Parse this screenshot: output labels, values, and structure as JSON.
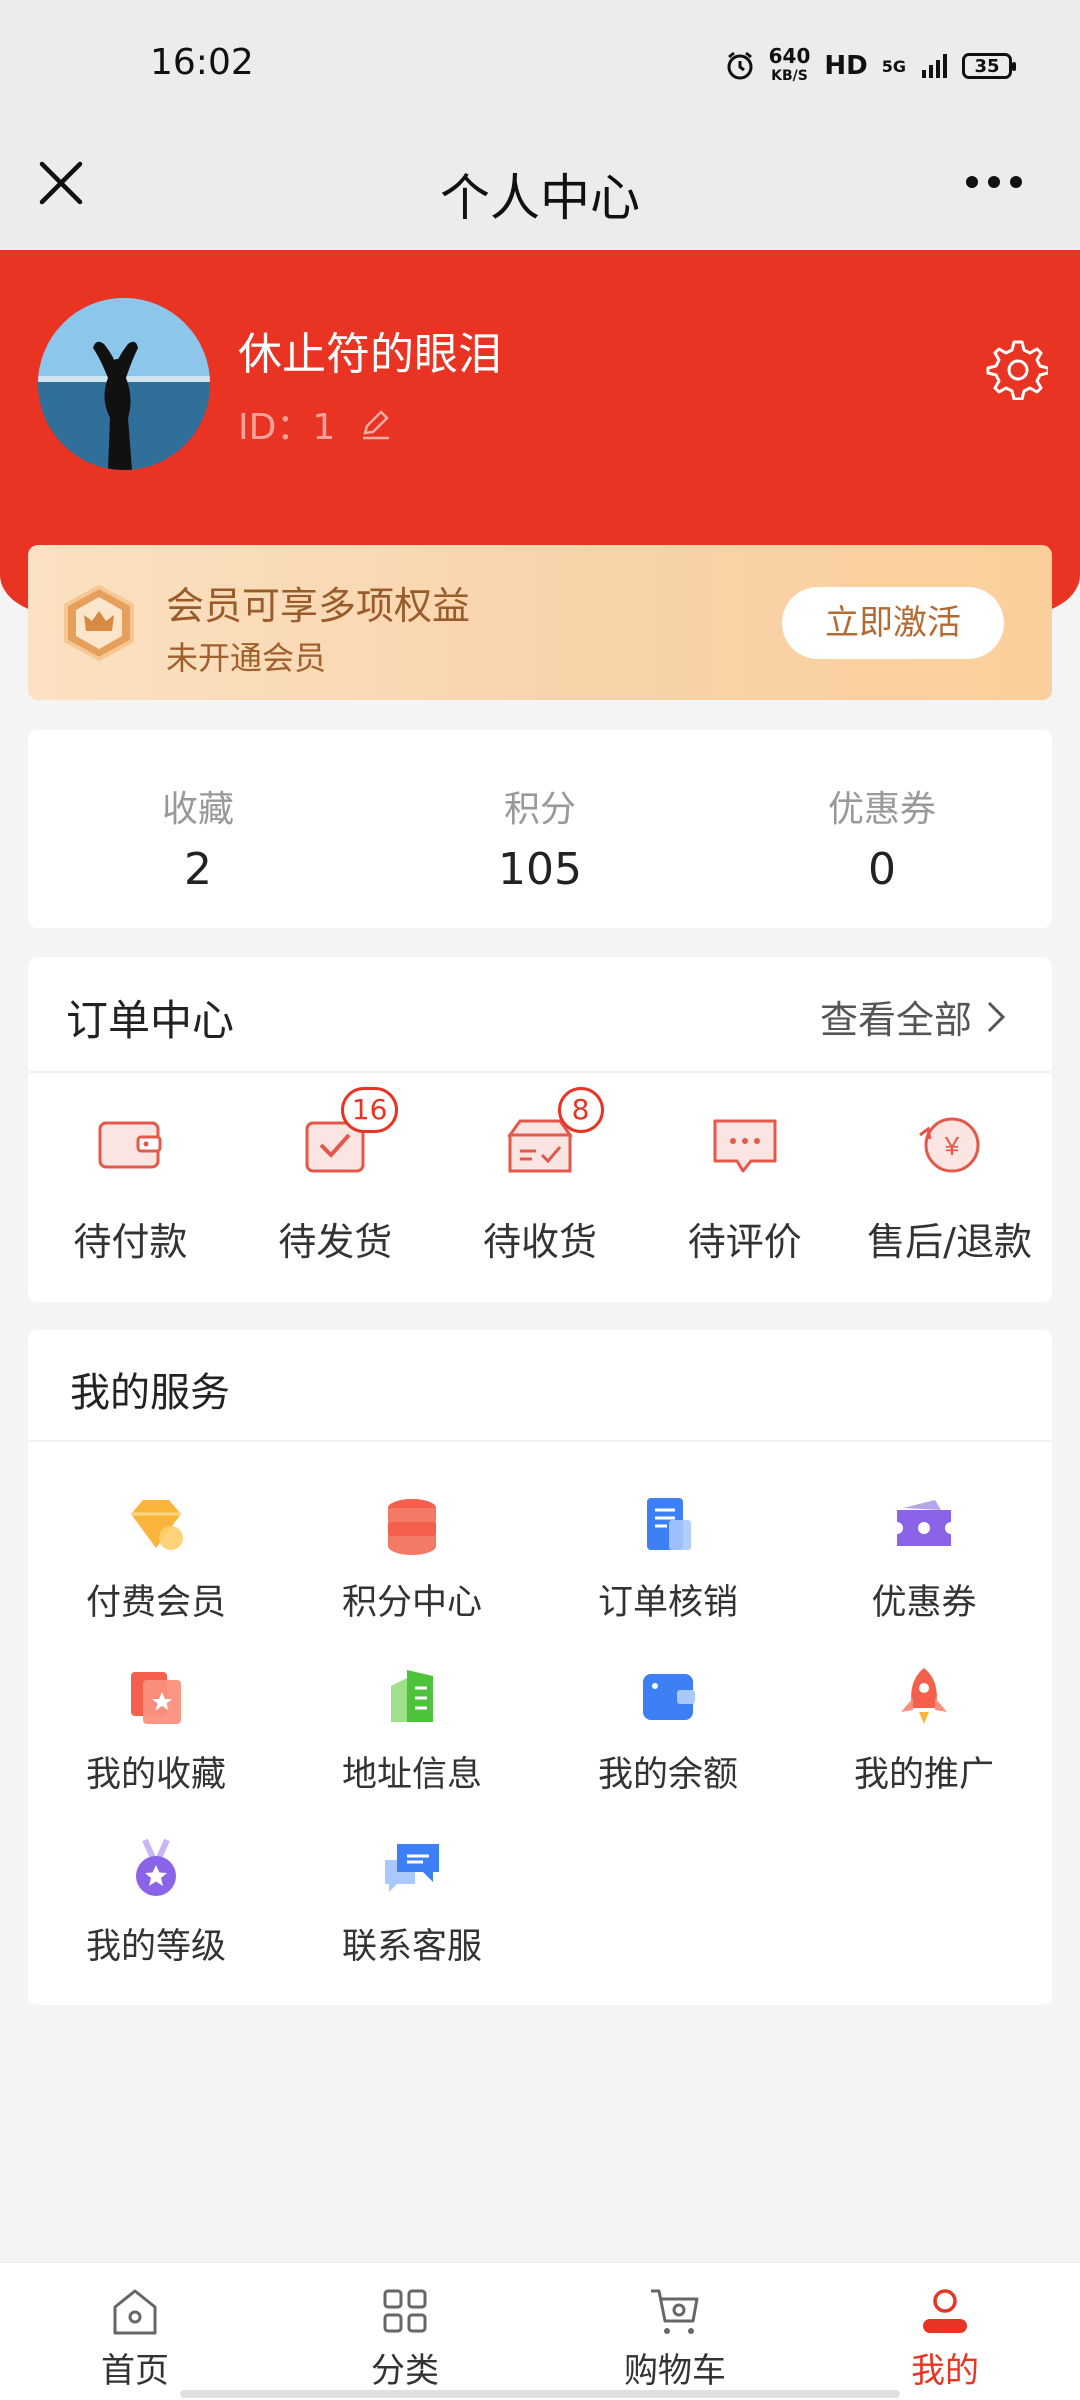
{
  "status_bar": {
    "time": "16:02",
    "net_speed_value": "640",
    "net_speed_unit": "KB/S",
    "hd": "HD",
    "network": "5G",
    "battery": "35"
  },
  "title_bar": {
    "title": "个人中心",
    "close_icon": "close-icon",
    "more_icon": "more-icon"
  },
  "user": {
    "name": "休止符的眼泪",
    "id_text": "ID：1"
  },
  "member": {
    "title": "会员可享多项权益",
    "subtitle": "未开通会员",
    "button": "立即激活"
  },
  "stats": [
    {
      "label": "收藏",
      "value": "2"
    },
    {
      "label": "积分",
      "value": "105"
    },
    {
      "label": "优惠券",
      "value": "0"
    }
  ],
  "orders": {
    "title": "订单中心",
    "view_all": "查看全部",
    "items": [
      {
        "label": "待付款",
        "icon": "wallet-icon",
        "badge": ""
      },
      {
        "label": "待发货",
        "icon": "box-check-icon",
        "badge": "16"
      },
      {
        "label": "待收货",
        "icon": "package-icon",
        "badge": "8"
      },
      {
        "label": "待评价",
        "icon": "comment-icon",
        "badge": ""
      },
      {
        "label": "售后/退款",
        "icon": "refund-icon",
        "badge": ""
      }
    ]
  },
  "services": {
    "title": "我的服务",
    "items": [
      {
        "label": "付费会员",
        "icon": "diamond-icon"
      },
      {
        "label": "积分中心",
        "icon": "coins-icon"
      },
      {
        "label": "订单核销",
        "icon": "document-icon"
      },
      {
        "label": "优惠券",
        "icon": "coupon-icon"
      },
      {
        "label": "我的收藏",
        "icon": "favorite-icon"
      },
      {
        "label": "地址信息",
        "icon": "building-icon"
      },
      {
        "label": "我的余额",
        "icon": "wallet-icon"
      },
      {
        "label": "我的推广",
        "icon": "rocket-icon"
      },
      {
        "label": "我的等级",
        "icon": "medal-icon"
      },
      {
        "label": "联系客服",
        "icon": "chat-icon"
      }
    ]
  },
  "tabs": [
    {
      "label": "首页",
      "icon": "home-icon"
    },
    {
      "label": "分类",
      "icon": "grid-icon"
    },
    {
      "label": "购物车",
      "icon": "cart-icon"
    },
    {
      "label": "我的",
      "icon": "user-icon"
    }
  ],
  "colors": {
    "brand_red": "#e93323",
    "member_brown": "#9a5b2a",
    "background": "#f4f4f4"
  }
}
